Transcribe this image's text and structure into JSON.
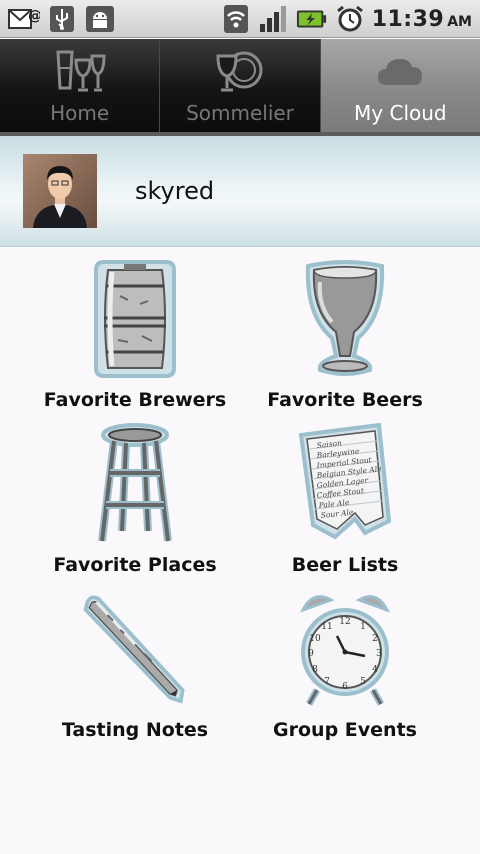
{
  "status_bar": {
    "left_icons": [
      "email-icon",
      "usb-icon",
      "android-debug-icon"
    ],
    "right_icons": [
      "wifi-icon",
      "signal-icon",
      "battery-charging-icon",
      "alarm-icon"
    ],
    "time": "11:39",
    "ampm": "AM"
  },
  "tabs": [
    {
      "label": "Home",
      "icon": "beer-glasses-icon",
      "active": false
    },
    {
      "label": "Sommelier",
      "icon": "plate-glass-icon",
      "active": false
    },
    {
      "label": "My Cloud",
      "icon": "cloud-icon",
      "active": true
    }
  ],
  "profile": {
    "username": "skyred"
  },
  "grid": [
    {
      "label": "Favorite Brewers",
      "icon": "keg-icon"
    },
    {
      "label": "Favorite Beers",
      "icon": "beer-snifter-icon"
    },
    {
      "label": "Favorite Places",
      "icon": "bar-stool-icon"
    },
    {
      "label": "Beer Lists",
      "icon": "beer-list-paper-icon"
    },
    {
      "label": "Tasting Notes",
      "icon": "pen-icon"
    },
    {
      "label": "Group Events",
      "icon": "alarm-clock-icon"
    }
  ],
  "beer_list_items": [
    "Saison",
    "Barleywine",
    "Imperial Stout",
    "Belgian Style Ale",
    "Golden Lager",
    "Coffee Stout",
    "Pale Ale",
    "Sour Ale"
  ]
}
